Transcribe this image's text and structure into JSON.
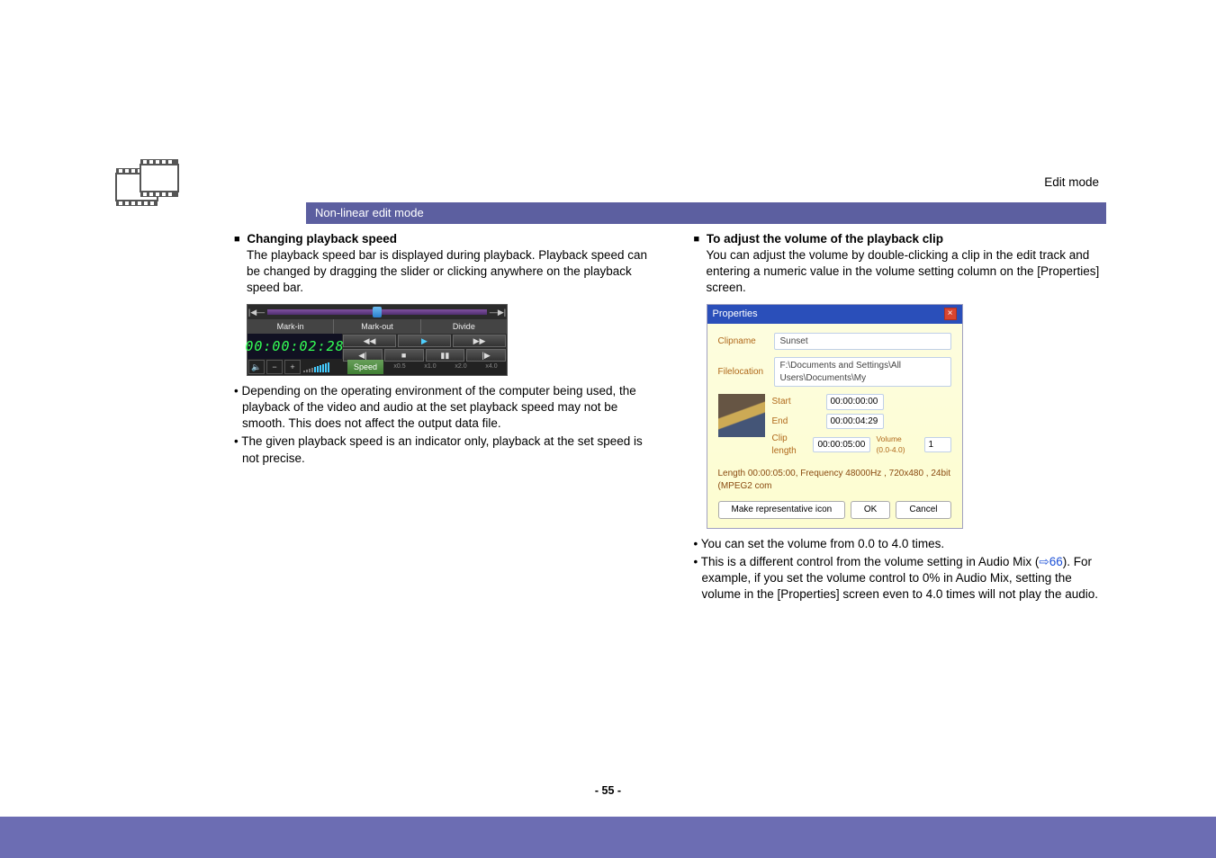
{
  "header": {
    "edit_mode_label": "Edit mode"
  },
  "section_bar": {
    "label": "Non-linear edit mode"
  },
  "page": {
    "number": "- 55 -"
  },
  "left": {
    "heading": "Changing playback speed",
    "p1": "The playback speed bar is displayed during playback. Playback speed can be changed by dragging the slider or clicking anywhere on the playback speed bar.",
    "bullet1": "Depending on the operating environment of the computer being used, the playback of the video and audio at the set playback speed may not be smooth. This does not affect the output data file.",
    "bullet2": "The given playback speed is an indicator only, playback at the set speed is not precise."
  },
  "left_ui": {
    "markin": "Mark-in",
    "markout": "Mark-out",
    "divide": "Divide",
    "clock": "00:00:02:28",
    "speed_label": "Speed",
    "sx05": "x0.5",
    "sx10": "x1.0",
    "sx20": "x2.0",
    "sx40": "x4.0"
  },
  "right": {
    "heading": "To adjust the volume of the playback clip",
    "p1": "You can adjust the volume by double-clicking a clip in the edit track and entering a numeric value in the volume setting column on the [Properties] screen.",
    "bullet1": "You can set the volume from 0.0 to 4.0 times.",
    "bullet2_a": "This is a different control from the volume setting in Audio Mix (",
    "bullet2_link": "66",
    "bullet2_b": "). For example, if you set the volume control to 0% in Audio Mix, setting the volume in the [Properties] screen even to 4.0 times will not play the audio."
  },
  "props": {
    "title": "Properties",
    "close": "×",
    "clipname_lbl": "Clipname",
    "clipname_val": "Sunset",
    "fileloc_lbl": "Filelocation",
    "fileloc_val": "F:\\Documents and Settings\\All Users\\Documents\\My",
    "start_lbl": "Start",
    "start_val": "00:00:00:00",
    "end_lbl": "End",
    "end_val": "00:00:04:29",
    "clen_lbl": "Clip length",
    "clen_val": "00:00:05:00",
    "vol_lbl": "Volume (0.0-4.0)",
    "vol_val": "1",
    "spec": "Length 00:00:05:00, Frequency 48000Hz , 720x480 , 24bit (MPEG2 com",
    "make_btn": "Make representative icon",
    "ok": "OK",
    "cancel": "Cancel"
  }
}
